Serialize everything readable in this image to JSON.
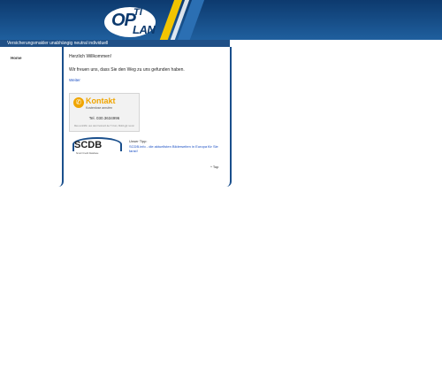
{
  "logo": {
    "letters_main": "OP",
    "letters_top": "TI",
    "letters_bottom": "LAN"
  },
  "tagline": "Versicherungsmakler unabhängig neutral individuell",
  "sidebar": {
    "home_label": "Home"
  },
  "main": {
    "greeting": "Herzlich Willkommen!",
    "intro": "Wir freuen uns, dass Sie den Weg zu uns gefunden haben.",
    "continue_link": "Weiter"
  },
  "contact_box": {
    "title": "Kontakt",
    "subtitle": "Kostenlose anrufen",
    "phone": "Tel. 030.3634996",
    "footer": "Max.cent/Min. aus dem Festnetz der T-Com, Mobil ggf. teurer"
  },
  "scdb": {
    "name": "SCDB",
    "suffix": "info",
    "subtitle": "Smart Credit Database"
  },
  "tip": {
    "label": "Unser Tipp:",
    "link_text": "SCDB.info - die aktuellsten Bilderseiten in Europa für Sie fanst!"
  },
  "top_link": "^ Top"
}
